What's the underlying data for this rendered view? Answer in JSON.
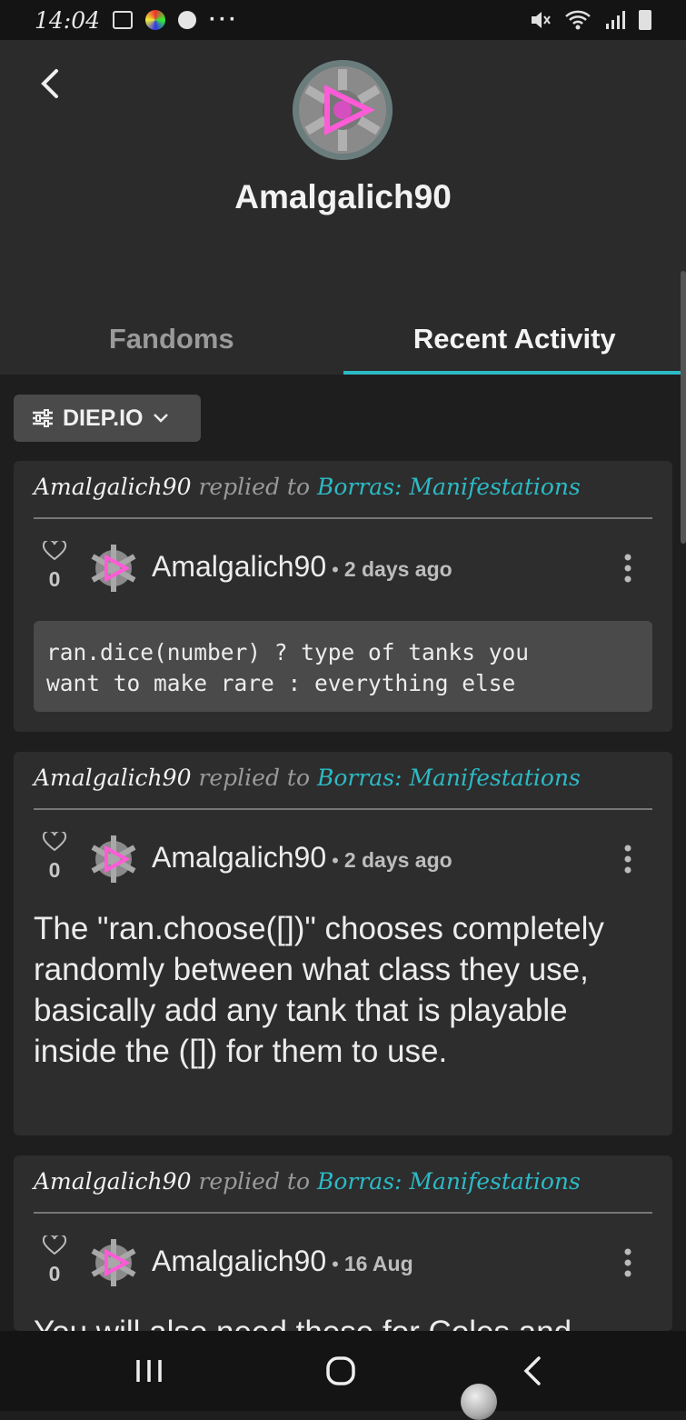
{
  "status_bar": {
    "time": "14:04",
    "icons_left": [
      "image-icon",
      "colorful-app-icon",
      "k-app-icon",
      "more-dots"
    ],
    "icons_right": [
      "mute-icon",
      "wifi-icon",
      "signal-icon",
      "battery-icon"
    ],
    "more_dots": "···"
  },
  "profile": {
    "username": "Amalgalich90"
  },
  "tabs": [
    {
      "label": "Fandoms",
      "selected": false
    },
    {
      "label": "Recent Activity",
      "selected": true
    }
  ],
  "filter": {
    "label": "DIEP.IO"
  },
  "colors": {
    "accent": "#2cbac5",
    "card": "#2d2d2d",
    "header": "#2b2b2b"
  },
  "activity": [
    {
      "context_user": "Amalgalich90",
      "context_verb": "replied to",
      "context_target": "Borras: Manifestations",
      "likes": "0",
      "author": "Amalgalich90",
      "dot": "•",
      "time": "2 days ago",
      "code": "ran.dice(number) ? type of tanks you\nwant to make rare : everything else"
    },
    {
      "context_user": "Amalgalich90",
      "context_verb": "replied to",
      "context_target": "Borras: Manifestations",
      "likes": "0",
      "author": "Amalgalich90",
      "dot": "•",
      "time": "2 days ago",
      "text": "The \"ran.choose([])\" chooses completely randomly between what class they use, basically add any tank that is playable inside the ([]) for them to use."
    },
    {
      "context_user": "Amalgalich90",
      "context_verb": "replied to",
      "context_target": "Borras: Manifestations",
      "likes": "0",
      "author": "Amalgalich90",
      "dot": "•",
      "time": "16 Aug",
      "text": "You will also need these for Coles and"
    }
  ]
}
